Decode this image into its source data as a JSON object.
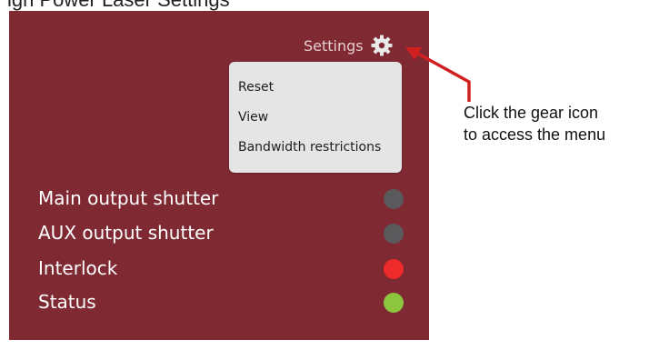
{
  "page": {
    "top_strip_text": "igh Power Laser Settings"
  },
  "settings": {
    "label": "Settings"
  },
  "menu": {
    "items": [
      {
        "label": "Reset"
      },
      {
        "label": "View"
      },
      {
        "label": "Bandwidth restrictions"
      }
    ]
  },
  "status": [
    {
      "label": "Main output shutter",
      "color": "#5a5a5c"
    },
    {
      "label": "AUX output shutter",
      "color": "#5a5a5c"
    },
    {
      "label": "Interlock",
      "color": "#ee2a2a"
    },
    {
      "label": "Status",
      "color": "#8cc63f"
    }
  ],
  "annotation": {
    "line1": "Click the gear icon",
    "line2": "to access the menu"
  },
  "colors": {
    "panel": "#7f2a33",
    "arrow": "#d0201f"
  }
}
